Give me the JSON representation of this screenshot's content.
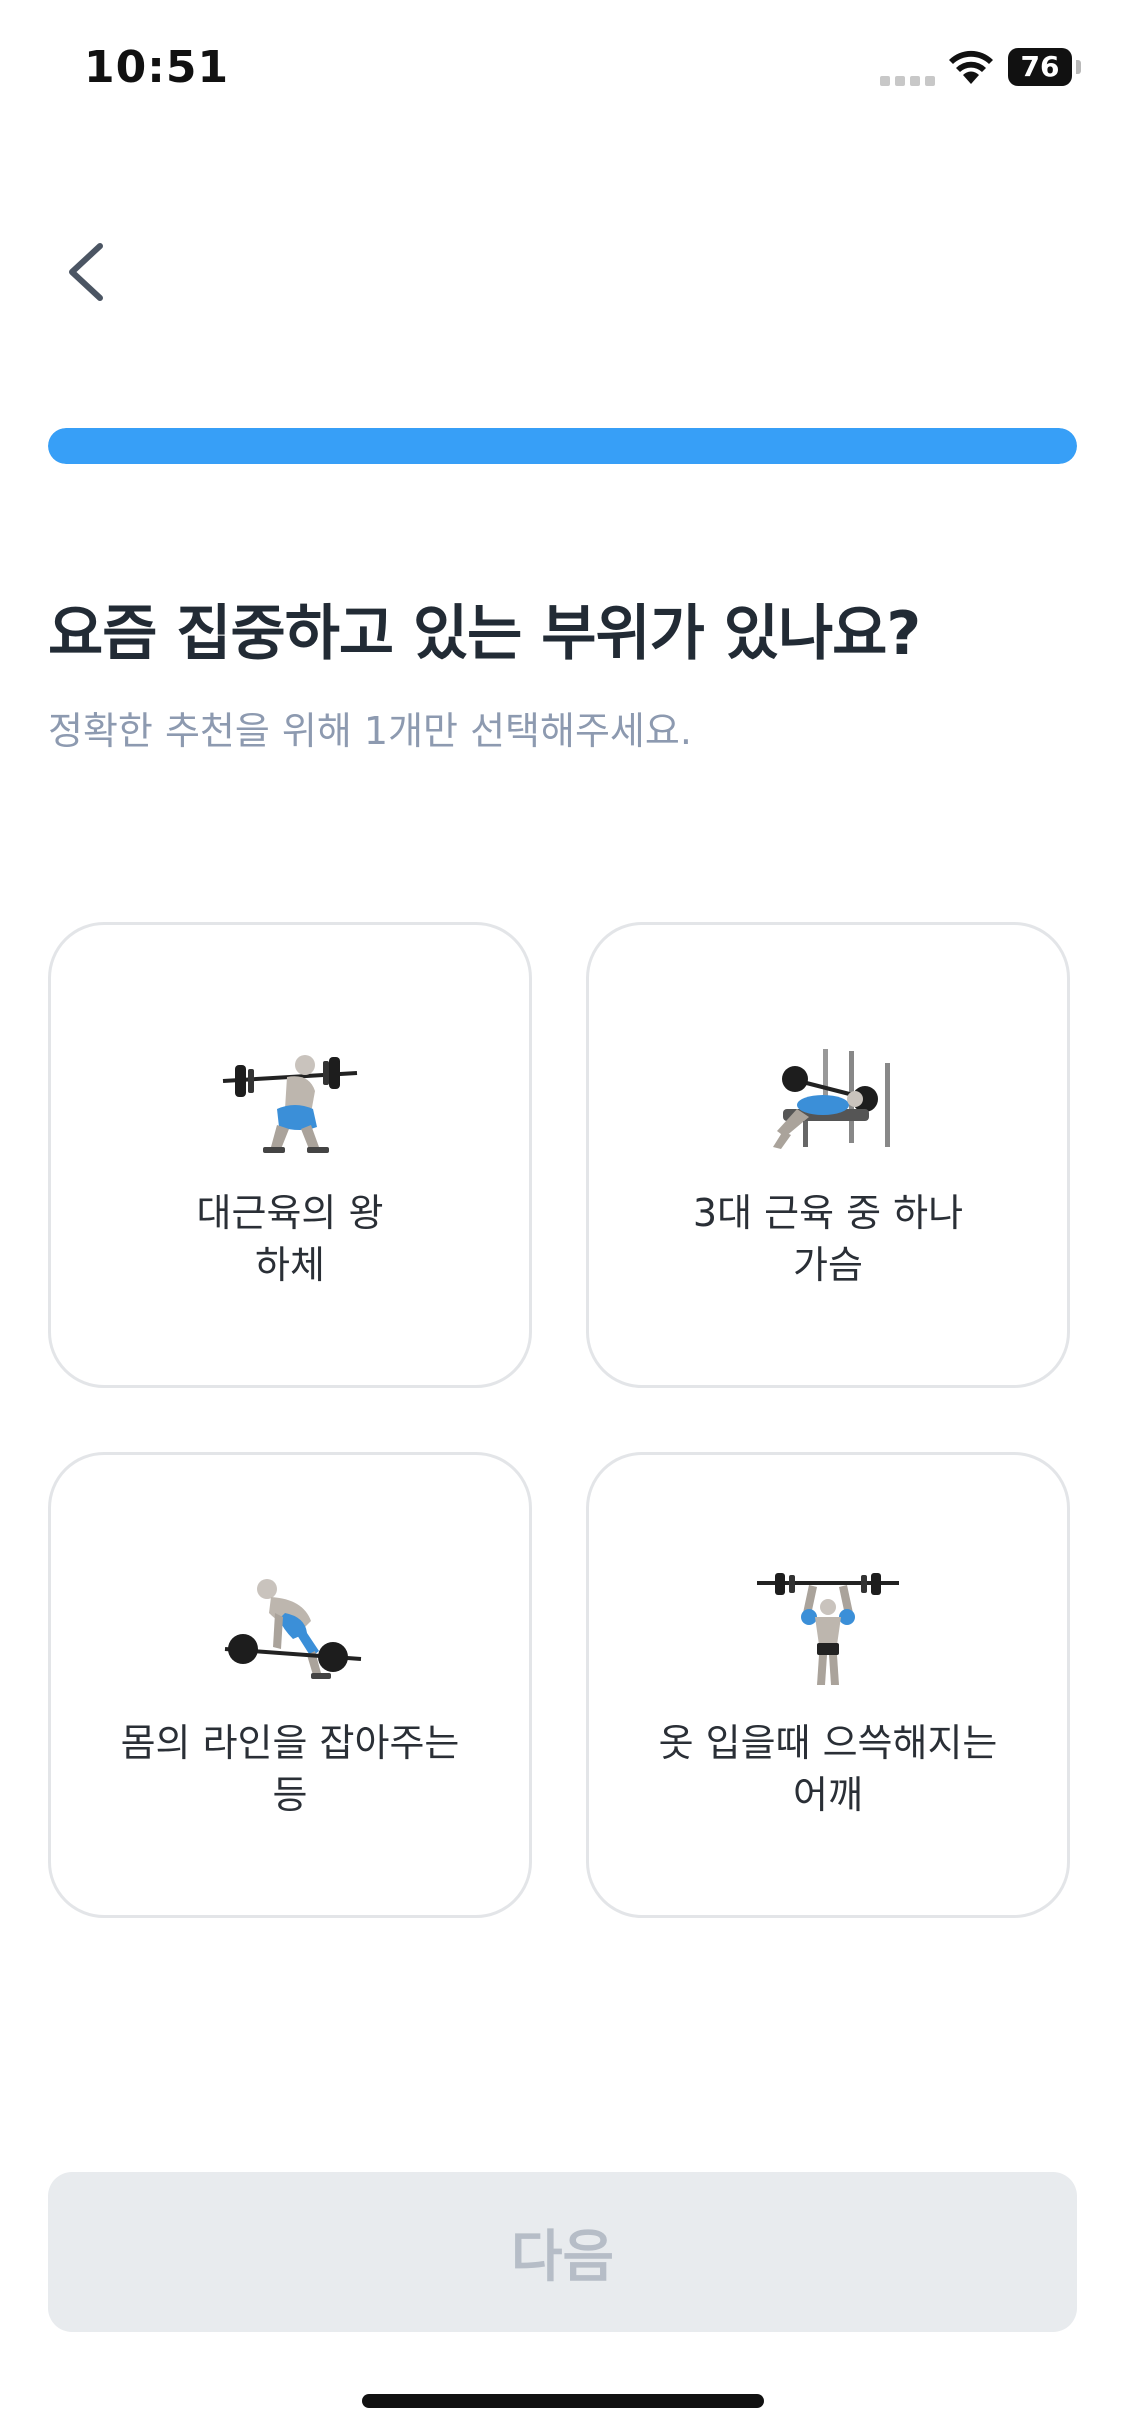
{
  "status_bar": {
    "time": "10:51",
    "battery": "76"
  },
  "progress": {
    "fraction": 1.0,
    "color": "#379ff7"
  },
  "question": {
    "title": "요즘 집중하고 있는 부위가 있나요?",
    "subtitle": "정확한 추천을 위해 1개만 선택해주세요."
  },
  "options": [
    {
      "caption": "대근육의 왕",
      "part": "하체",
      "icon": "barbell-squat-icon"
    },
    {
      "caption": "3대 근육 중 하나",
      "part": "가슴",
      "icon": "bench-press-icon"
    },
    {
      "caption": "몸의 라인을 잡아주는",
      "part": "등",
      "icon": "barbell-row-icon"
    },
    {
      "caption": "옷 입을때 으쓱해지는",
      "part": "어깨",
      "icon": "overhead-press-icon"
    }
  ],
  "footer": {
    "next_label": "다음"
  },
  "colors": {
    "accent": "#379ff7",
    "title": "#222b35",
    "subtitle": "#8d9ab0",
    "disabled_bg": "#e8ebee",
    "disabled_text": "#b6bdc7"
  }
}
